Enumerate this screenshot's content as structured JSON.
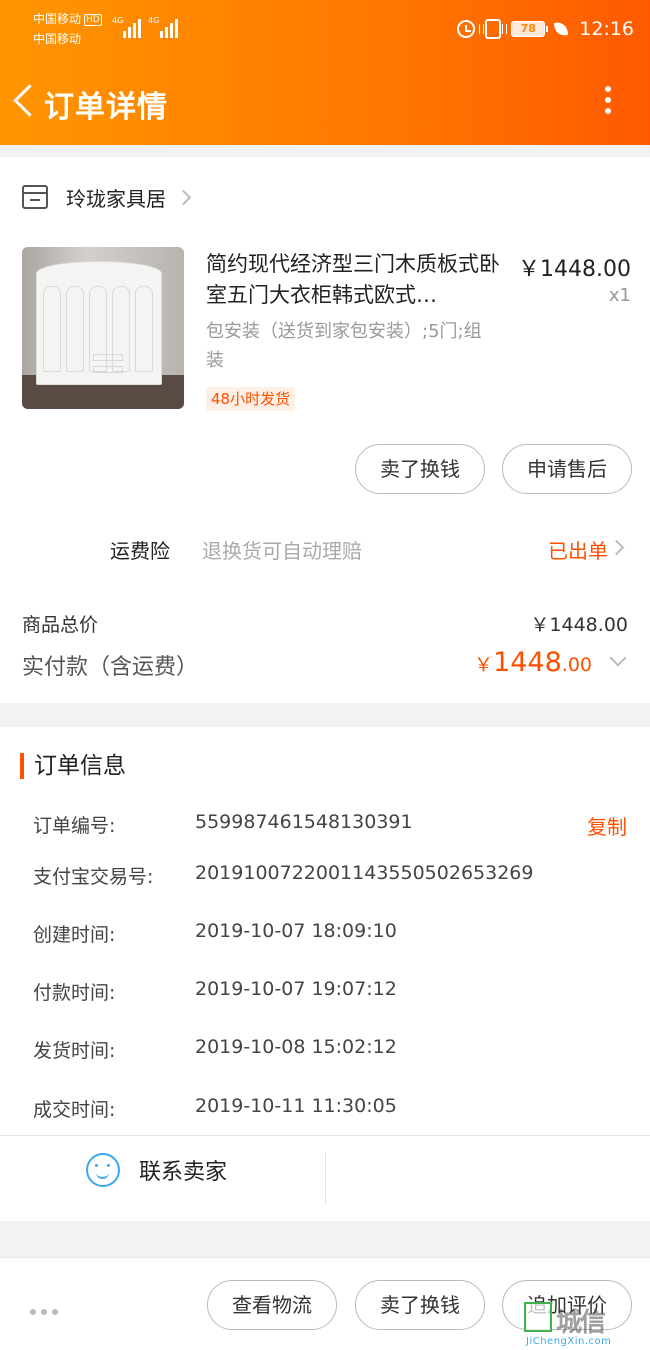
{
  "status_bar": {
    "carrier1": "中国移动",
    "hd": "HD",
    "carrier2": "中国移动",
    "net1": "4G",
    "net2": "4G",
    "battery": "78",
    "time": "12:16"
  },
  "header": {
    "title": "订单详情"
  },
  "shop": {
    "name": "玲珑家具居"
  },
  "item": {
    "name": "简约现代经济型三门木质板式卧室五门大衣柜韩式欧式…",
    "price": "￥1448.00",
    "quantity": "x1",
    "sku": "包安装（送货到家包安装）;5门;组装",
    "tag": "48小时发货",
    "buttons": {
      "sell": "卖了换钱",
      "after_sale": "申请售后"
    }
  },
  "insurance": {
    "label": "运费险",
    "desc": "退换货可自动理赔",
    "status": "已出单"
  },
  "totals": {
    "goods_label": "商品总价",
    "goods_value": "￥1448.00",
    "paid_label": "实付款（含运费）",
    "paid_yen": "￥",
    "paid_int": "1448",
    "paid_dec": ".00"
  },
  "order_info": {
    "title": "订单信息",
    "copy": "复制",
    "rows": [
      {
        "label": "订单编号:",
        "value": "559987461548130391"
      },
      {
        "label": "支付宝交易号:",
        "value": "2019100722001143550502653269"
      },
      {
        "label": "创建时间:",
        "value": "2019-10-07 18:09:10"
      },
      {
        "label": "付款时间:",
        "value": "2019-10-07 19:07:12"
      },
      {
        "label": "发货时间:",
        "value": "2019-10-08 15:02:12"
      },
      {
        "label": "成交时间:",
        "value": "2019-10-11 11:30:05"
      }
    ],
    "contact": "联系卖家"
  },
  "bottom_bar": {
    "logistics": "查看物流",
    "sell": "卖了换钱",
    "review": "追加评价"
  },
  "watermark": {
    "text": "城信",
    "site": "JiChengXin.com"
  },
  "colors": {
    "accent": "#ff5000",
    "header_start": "#ff9500",
    "header_end": "#ff5a00",
    "chat_blue": "#3ba8ee"
  },
  "icons": [
    "back-arrow-icon",
    "more-vertical-icon",
    "store-icon",
    "chevron-right-icon",
    "chevron-down-icon",
    "wangwang-chat-icon",
    "alarm-icon",
    "vibrate-icon",
    "battery-icon",
    "leaf-icon"
  ]
}
